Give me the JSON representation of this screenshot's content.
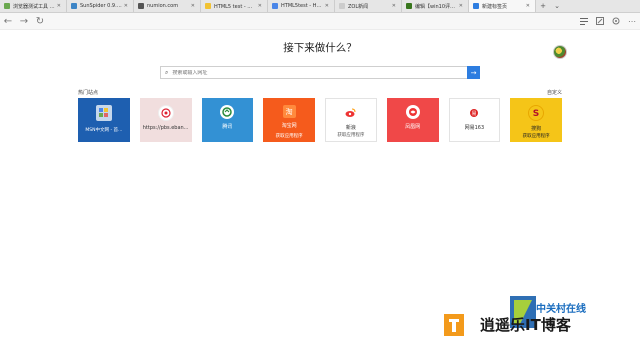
{
  "tabs": [
    {
      "title": "浏览器测试工具 - 浏览器",
      "favicon_color": "#6aa84f",
      "active": false
    },
    {
      "title": "SunSpider 0.9.1 JavaScript",
      "favicon_color": "#3d85c6",
      "active": false
    },
    {
      "title": "numion.com",
      "favicon_color": "#555555",
      "active": false
    },
    {
      "title": "HTML5 test - 必应",
      "favicon_color": "#f1c232",
      "active": false
    },
    {
      "title": "HTML5test - How well do",
      "favicon_color": "#4a86e8",
      "active": false
    },
    {
      "title": "ZOL新闻",
      "favicon_color": "#cccccc",
      "active": false
    },
    {
      "title": "编辑【win10评测】- 文",
      "favicon_color": "#38761d",
      "active": false
    },
    {
      "title": "新建标签页",
      "favicon_color": "#2d7de0",
      "active": true
    }
  ],
  "tab_controls": {
    "new_tab": "+",
    "more": "⌄"
  },
  "toolbar": {
    "back": "←",
    "forward": "→",
    "refresh": "↻"
  },
  "toolbar_icons": [
    "reading-list",
    "web-note",
    "share",
    "more"
  ],
  "heading": "接下来做什么？",
  "search": {
    "placeholder": "搜索或输入网址",
    "value": ""
  },
  "section": {
    "title": "热门站点",
    "customize": "自定义"
  },
  "tiles": [
    {
      "label": "MSN中文网 - 首...",
      "sub": "",
      "icon": "msn-icon",
      "style": "t-msn"
    },
    {
      "label": "https://pbs.eban...",
      "sub": "",
      "icon": "pbs-icon",
      "style": "t-pbs"
    },
    {
      "label": "腾讯",
      "sub": "",
      "icon": "tencent-icon",
      "style": "t-tx"
    },
    {
      "label": "淘宝网",
      "sub": "获取应用程序",
      "icon": "taobao-icon",
      "style": "t-tb"
    },
    {
      "label": "新浪",
      "sub": "获取应用程序",
      "icon": "sina-icon",
      "style": "t-sina"
    },
    {
      "label": "凤凰网",
      "sub": "",
      "icon": "ifeng-icon",
      "style": "t-fh"
    },
    {
      "label": "网易163",
      "sub": "",
      "icon": "netease-icon",
      "style": "t-163"
    },
    {
      "label": "搜狗",
      "sub": "获取应用程序",
      "icon": "sogou-icon",
      "style": "t-bd"
    }
  ],
  "watermark": {
    "line1": "中关村在线",
    "line2": "逍遥乐IT博客"
  }
}
